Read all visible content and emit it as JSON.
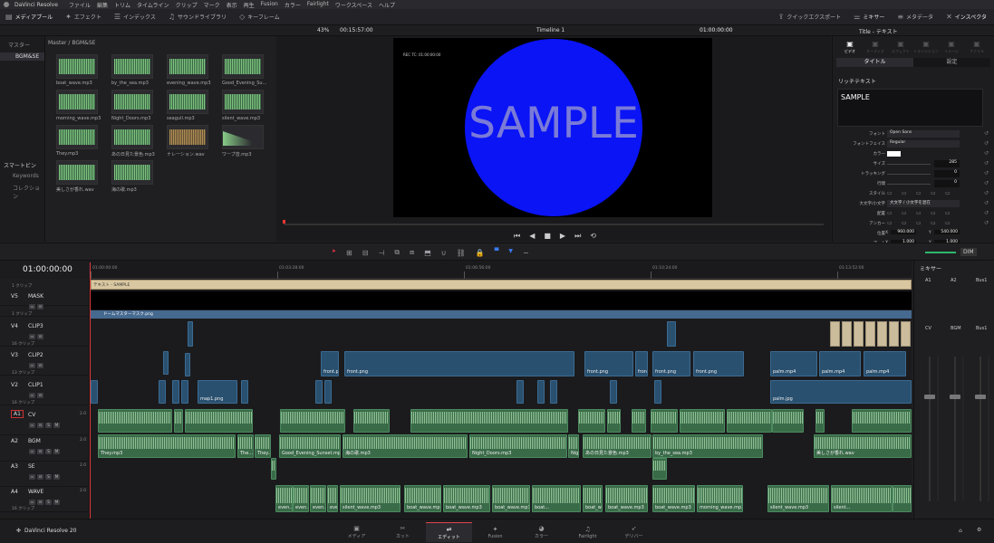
{
  "window": {
    "title": "DaVinci Resolve"
  },
  "menu": [
    "ファイル",
    "編集",
    "トリム",
    "タイムライン",
    "クリップ",
    "マーク",
    "表示",
    "再生",
    "Fusion",
    "カラー",
    "Fairlight",
    "ワークスペース",
    "ヘルプ"
  ],
  "toolbar": {
    "media_pool": "メディアプール",
    "effects": "エフェクト",
    "index": "インデックス",
    "sound_library": "サウンドライブラリ",
    "keyframe": "キーフレーム",
    "quick_export": "クイックエクスポート",
    "mixer": "ミキサー",
    "metadata": "メタデータ",
    "inspector": "インスペクタ"
  },
  "viewer_bar": {
    "zoom": "43%",
    "duration": "00:15:57:00",
    "timeline_name": "Timeline 1",
    "timecode": "01:00:00:00"
  },
  "media_pool": {
    "bins_header": "マスター",
    "bin_selected": "BGM&SE",
    "breadcrumb": "Master / BGM&SE",
    "clips": [
      {
        "name": "boat_wave.mp3",
        "kind": "green"
      },
      {
        "name": "by_the_sea.mp3",
        "kind": "green"
      },
      {
        "name": "evening_wave.mp3",
        "kind": "green"
      },
      {
        "name": "Good_Evening_Su...",
        "kind": "green"
      },
      {
        "name": "morning_wave.mp3",
        "kind": "green"
      },
      {
        "name": "Night_Doors.mp3",
        "kind": "green"
      },
      {
        "name": "seagull.mp3",
        "kind": "green"
      },
      {
        "name": "silent_wave.mp3",
        "kind": "green"
      },
      {
        "name": "They.mp3",
        "kind": "green"
      },
      {
        "name": "あの日見た景色.mp3",
        "kind": "green"
      },
      {
        "name": "ナレーション.wav",
        "kind": "orange"
      },
      {
        "name": "ワープ音.mp3",
        "kind": "ramp"
      },
      {
        "name": "美しさが香れ.wav",
        "kind": "green"
      },
      {
        "name": "海の歌.mp3",
        "kind": "green"
      }
    ],
    "smart_bins": "スマートビン",
    "keywords": "Keywords",
    "collections": "コレクション"
  },
  "viewer": {
    "rec_tc": "REC TC: 01:00:00:00",
    "sample_text": "SAMPLE",
    "circle_color": "#0a14f5"
  },
  "inspector": {
    "title": "Title - テキスト",
    "tabs": [
      "ビデオ",
      "オーディオ",
      "エフェクト",
      "トランジション",
      "イメージ",
      "ファイル"
    ],
    "subtabs": [
      "タイトル",
      "設定"
    ],
    "rich_text_label": "リッチテキスト",
    "text_value": "SAMPLE",
    "rows": [
      {
        "label": "フォント",
        "value": "Open Sans"
      },
      {
        "label": "フォントフェイス",
        "value": "Regular"
      },
      {
        "label": "カラー",
        "value": ""
      },
      {
        "label": "サイズ",
        "value": "285"
      },
      {
        "label": "トラッキング",
        "value": "0"
      },
      {
        "label": "行間",
        "value": "0"
      },
      {
        "label": "スタイル",
        "value": ""
      },
      {
        "label": "大文字/小文字",
        "value": "大文字 / 小文字を混在"
      },
      {
        "label": "配置",
        "value": ""
      },
      {
        "label": "アンカー",
        "value": ""
      }
    ],
    "position_label": "位置",
    "pos_x_label": "X",
    "pos_x": "960.000",
    "pos_y_label": "Y",
    "pos_y": "540.000",
    "zoom_label": "ズーム",
    "zoom_x_label": "X",
    "zoom_x": "1.000",
    "zoom_y_label": "Y",
    "zoom_y": "1.000"
  },
  "timeline": {
    "timecode": "01:00:00:00",
    "ruler": [
      "01:00:00:00",
      "01:03:28:00",
      "01:06:56:00",
      "01:10:24:00",
      "01:13:52:00"
    ],
    "tracks": [
      {
        "id": "",
        "name": "",
        "count": "1 クリップ"
      },
      {
        "id": "V5",
        "name": "MASK",
        "count": "1 クリップ"
      },
      {
        "id": "V4",
        "name": "CLIP3",
        "count": "16 クリップ"
      },
      {
        "id": "V3",
        "name": "CLIP2",
        "count": "13 クリップ"
      },
      {
        "id": "V2",
        "name": "CLIP1",
        "count": "16 クリップ"
      },
      {
        "id": "A1",
        "name": "CV",
        "gain": "2.0"
      },
      {
        "id": "A2",
        "name": "BGM",
        "gain": "2.0"
      },
      {
        "id": "A3",
        "name": "SE",
        "gain": "2.0"
      },
      {
        "id": "A4",
        "name": "WAVE",
        "gain": "2.0",
        "count": "16 クリップ"
      }
    ],
    "text_clip": "テキスト - SAMPLE",
    "mask_clip": "ドームマスターマスク.png",
    "front_png": "front.png",
    "palm_mp4": "palm.mp4",
    "palm_jpg": "palm.jpg",
    "map_png": "map1.png",
    "bgm_clips": [
      "They.mp3",
      "The...",
      "They...",
      "Good_Evening_Sunset.mp3",
      "海の歌.mp3",
      "Night_Doors.mp3",
      "Nig...",
      "あの日見た景色.mp3",
      "by_the_sea.mp3",
      "美しさが香れ.wav"
    ],
    "wave_clips": [
      "even...",
      "even...",
      "even...",
      "even...",
      "silent_wave.mp3",
      "boat_wave.mp3",
      "boat_wave.mp3",
      "boat_wave.mp3",
      "boat...",
      "boat_wave.mp3",
      "boat_wave.mp3",
      "boat_wave.mp3",
      "morning_wave.mp3",
      "silent_wave.mp3",
      "silent..."
    ]
  },
  "mixer": {
    "title": "ミキサー",
    "channels": [
      "A1",
      "A2",
      "Bus1"
    ],
    "channels2": [
      "CV",
      "BGM",
      "Bus1"
    ],
    "dim": "DIM"
  },
  "pages": [
    "メディア",
    "カット",
    "エディット",
    "Fusion",
    "カラー",
    "Fairlight",
    "デリバー"
  ],
  "active_page": "エディット",
  "brand": "DaVinci Resolve 20"
}
